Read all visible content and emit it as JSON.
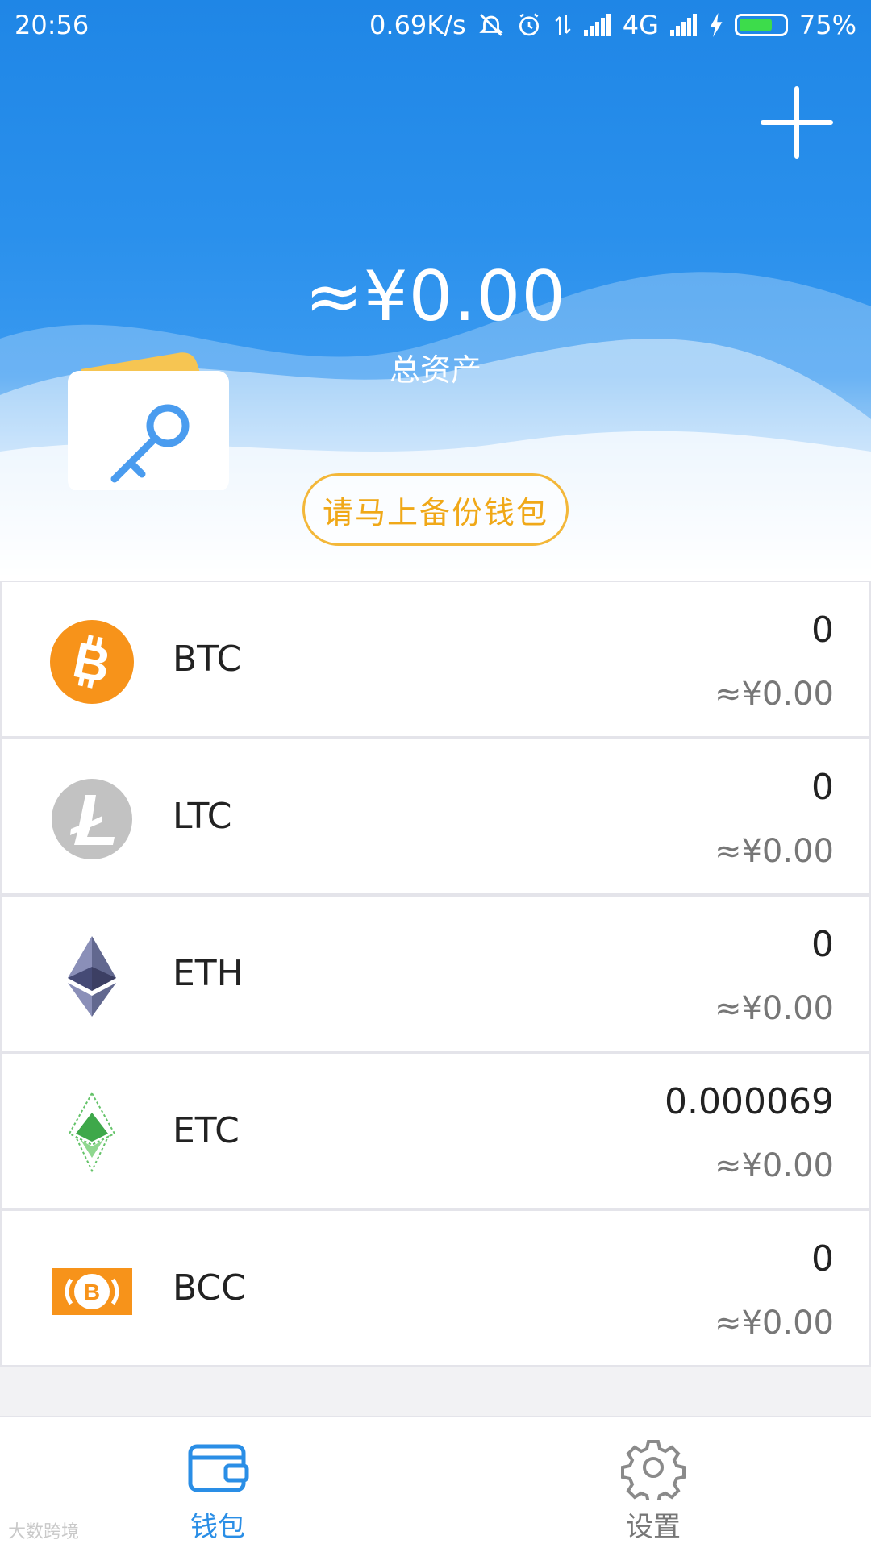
{
  "status_bar": {
    "time": "20:56",
    "speed": "0.69K/s",
    "network": "4G",
    "battery_percent": "75%",
    "battery_level": 0.75
  },
  "header": {
    "total_amount": "≈¥0.00",
    "total_label": "总资产",
    "backup_button": "请马上备份钱包",
    "add_icon": "plus-icon"
  },
  "coins": [
    {
      "name": "BTC",
      "amount": "0",
      "value": "≈¥0.00",
      "icon": "bitcoin-icon"
    },
    {
      "name": "LTC",
      "amount": "0",
      "value": "≈¥0.00",
      "icon": "litecoin-icon"
    },
    {
      "name": "ETH",
      "amount": "0",
      "value": "≈¥0.00",
      "icon": "ethereum-icon"
    },
    {
      "name": "ETC",
      "amount": "0.000069",
      "value": "≈¥0.00",
      "icon": "ethereum-classic-icon"
    },
    {
      "name": "BCC",
      "amount": "0",
      "value": "≈¥0.00",
      "icon": "bitcoin-cash-icon"
    }
  ],
  "bottom_nav": {
    "wallet_label": "钱包",
    "settings_label": "设置"
  },
  "watermark": "大数跨境",
  "colors": {
    "primary_blue": "#2a8ee6",
    "accent_orange": "#f3b739",
    "btc_orange": "#f7931a"
  }
}
